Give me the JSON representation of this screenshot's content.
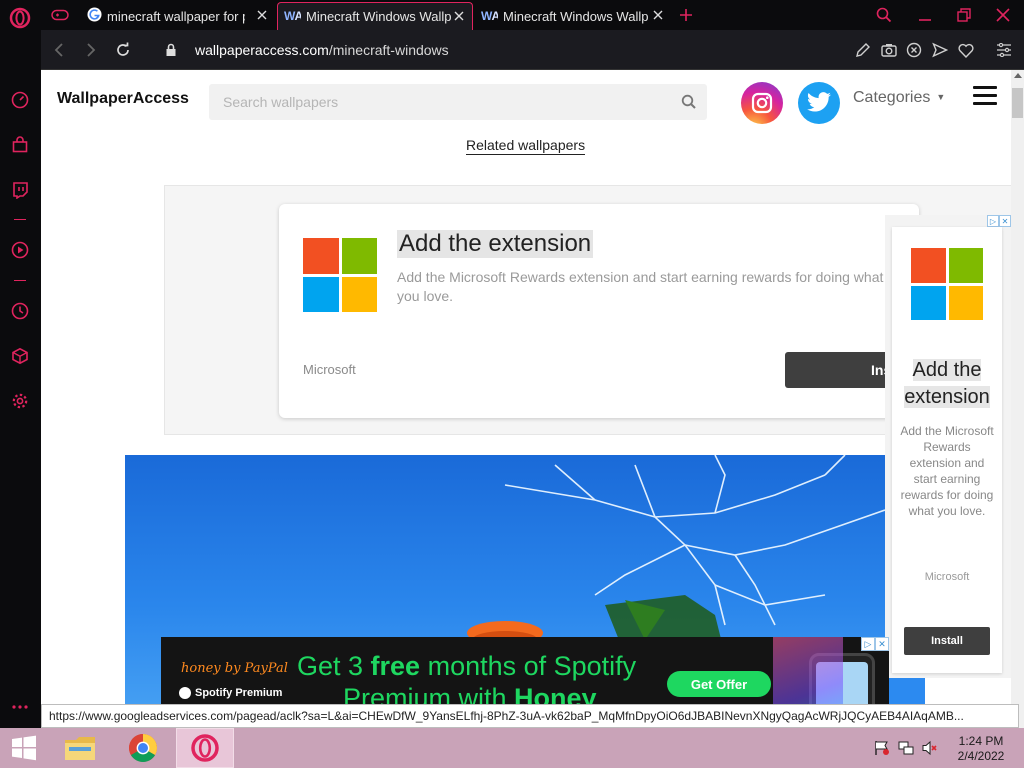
{
  "browser": {
    "tabs": [
      {
        "label": "minecraft wallpaper for pc",
        "favicon": "google-icon"
      },
      {
        "label": "Minecraft Windows Wallpa",
        "favicon": "wallpaperaccess-icon",
        "active": true
      },
      {
        "label": "Minecraft Windows Wallpa",
        "favicon": "wallpaperaccess-icon"
      }
    ],
    "url": {
      "domain": "wallpaperaccess.com",
      "path": "/minecraft-windows"
    },
    "status_url": "https://www.googleadservices.com/pagead/aclk?sa=L&ai=CHEwDfW_9YansELfhj-8PhZ-3uA-vk62baP_MqMfnDpyOiO6dJBABINevnXNgyQagAcWRjJQCyAEB4AIAqAMB...",
    "accent_color": "#e0245e"
  },
  "site": {
    "logo": "WallpaperAccess",
    "search_placeholder": "Search wallpapers",
    "categories_label": "Categories",
    "related_label": "Related wallpapers"
  },
  "ad_main": {
    "title": "Add the extension",
    "description": "Add the Microsoft Rewards extension and start earning rewards for doing what you love.",
    "brand": "Microsoft",
    "install_label": "Install"
  },
  "ad_side": {
    "title_line1": "Add the",
    "title_line2": "extension",
    "description": "Add the Microsoft Rewards extension and start earning rewards for doing what you love.",
    "brand": "Microsoft",
    "install_label": "Install"
  },
  "ad_bottom": {
    "logo": "honey by PayPal",
    "spotify": "Spotify Premium",
    "line1_pre": "Get 3 ",
    "line1_bold": "free",
    "line1_post": " months of Spotify",
    "line2_pre": "Premium with ",
    "line2_bold": "Honey",
    "cta": "Get Offer"
  },
  "taskbar": {
    "time": "1:24 PM",
    "date": "2/4/2022"
  }
}
